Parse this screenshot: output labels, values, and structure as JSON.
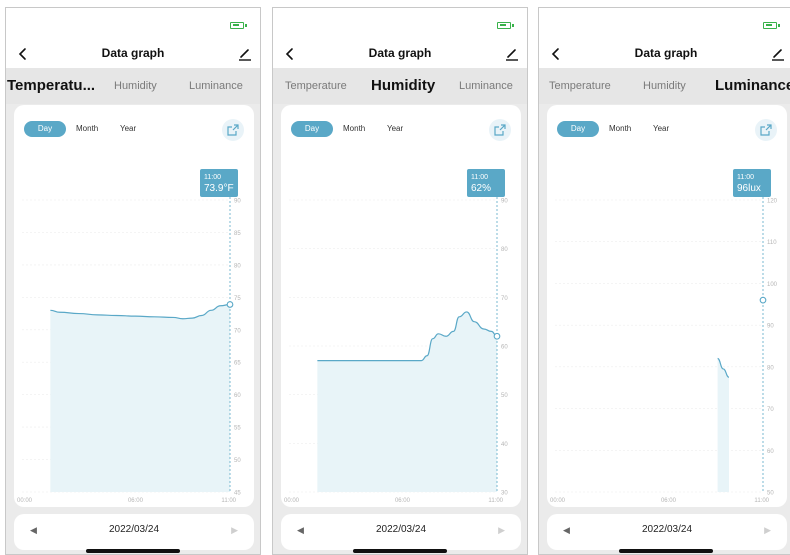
{
  "nav": {
    "title": "Data graph"
  },
  "tabs": [
    "Temperatu...",
    "Humidity",
    "Luminance"
  ],
  "tabs_full": [
    "Temperature",
    "Humidity",
    "Luminance"
  ],
  "ranges": [
    "Day",
    "Month",
    "Year"
  ],
  "date": "2022/03/24",
  "icons": {
    "back": "chevron-left-icon",
    "edit": "pencil-icon",
    "share": "share-icon",
    "battery": "battery-icon",
    "prev": "triangle-left-icon",
    "next": "triangle-right-icon"
  },
  "colors": {
    "accent": "#5aa8c7",
    "fill": "#e8f4f8",
    "battery": "#38b24a"
  },
  "screens": [
    {
      "active_tab": 0,
      "tooltip": {
        "time": "11:00",
        "value": "73.9°F"
      },
      "chart_data": {
        "type": "area",
        "x_ticks": [
          "00:00",
          "06:00",
          "11:00"
        ],
        "y_ticks": [
          "90",
          "85",
          "80",
          "75",
          "70",
          "65",
          "60",
          "55",
          "50",
          "45"
        ],
        "ylim": [
          45,
          90
        ],
        "x_hours": [
          1.5,
          2,
          3,
          4,
          5,
          6,
          7,
          8,
          8.5,
          9,
          9.5,
          10,
          10.5,
          11
        ],
        "values": [
          73.0,
          72.7,
          72.5,
          72.3,
          72.2,
          72.1,
          72.0,
          71.9,
          71.7,
          71.8,
          72.2,
          73.0,
          73.7,
          73.9
        ]
      }
    },
    {
      "active_tab": 1,
      "tooltip": {
        "time": "11:00",
        "value": "62%"
      },
      "chart_data": {
        "type": "area",
        "x_ticks": [
          "00:00",
          "06:00",
          "11:00"
        ],
        "y_ticks": [
          "90",
          "80",
          "70",
          "60",
          "50",
          "40",
          "30"
        ],
        "ylim": [
          30,
          90
        ],
        "x_hours": [
          1.5,
          2,
          3,
          4,
          5,
          6,
          6.2,
          6.6,
          7,
          7.3,
          7.6,
          7.9,
          8.3,
          8.7,
          9.0,
          9.4,
          9.8,
          10.3,
          10.7,
          11
        ],
        "values": [
          57,
          57,
          57,
          57,
          57,
          57,
          57,
          57,
          57,
          58,
          61.5,
          62.5,
          62,
          63,
          66,
          67,
          65,
          63.5,
          63,
          62
        ]
      }
    },
    {
      "active_tab": 2,
      "tooltip": {
        "time": "11:00",
        "value": "96lux"
      },
      "chart_data": {
        "type": "area",
        "x_ticks": [
          "00:00",
          "06:00",
          "11:00"
        ],
        "y_ticks": [
          "120",
          "110",
          "100",
          "90",
          "80",
          "70",
          "60",
          "50"
        ],
        "ylim": [
          50,
          120
        ],
        "x_hours": [
          8.6,
          8.9,
          9.2
        ],
        "values": [
          82,
          79.5,
          77.5
        ],
        "marker": {
          "x_hour": 11,
          "value": 96
        }
      }
    }
  ]
}
